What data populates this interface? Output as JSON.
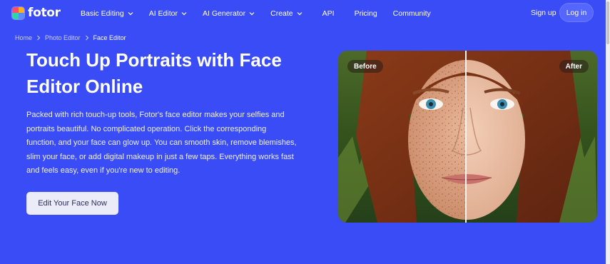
{
  "brand": {
    "name": "fotor",
    "logo_colors": [
      "#ff4d6d",
      "#ffb020",
      "#2ad7a6",
      "#5b8cff"
    ]
  },
  "nav": {
    "items": [
      {
        "label": "Basic Editing",
        "dropdown": true
      },
      {
        "label": "AI Editor",
        "dropdown": true
      },
      {
        "label": "AI Generator",
        "dropdown": true
      },
      {
        "label": "Create",
        "dropdown": true
      },
      {
        "label": "API",
        "dropdown": false
      },
      {
        "label": "Pricing",
        "dropdown": false
      },
      {
        "label": "Community",
        "dropdown": false
      }
    ],
    "signup_label": "Sign up",
    "login_label": "Log in"
  },
  "breadcrumb": {
    "home": "Home",
    "photo_editor": "Photo Editor",
    "current": "Face Editor"
  },
  "hero": {
    "title": "Touch Up Portraits with Face Editor Online",
    "description": "Packed with rich touch-up tools, Fotor's face editor makes your selfies and portraits beautiful. No complicated operation. Click the corresponding function, and your face can glow up. You can smooth skin, remove blemishes, slim your face, or add digital makeup in just a few taps. Everything works fast and feels easy, even if you're new to editing.",
    "cta_label": "Edit Your Face Now"
  },
  "compare": {
    "before_label": "Before",
    "after_label": "After"
  },
  "colors": {
    "background": "#3a4cf6",
    "cta_bg": "#ececf8",
    "login_bg": "#5566ff"
  }
}
